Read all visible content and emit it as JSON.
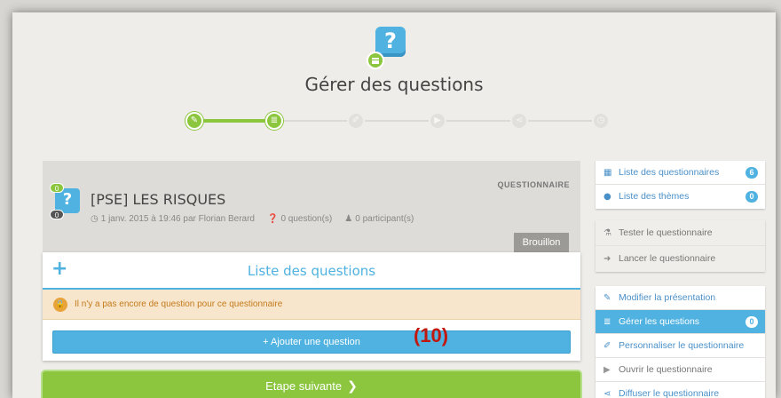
{
  "header": {
    "title": "Gérer des questions",
    "logo_icon": "question-mark-icon"
  },
  "stepper": {
    "steps": [
      {
        "icon": "pencil-icon",
        "glyph": "✎",
        "state": "done"
      },
      {
        "icon": "list-icon",
        "glyph": "≣",
        "state": "current"
      },
      {
        "icon": "brush-icon",
        "glyph": "✐",
        "state": "todo"
      },
      {
        "icon": "play-icon",
        "glyph": "▶",
        "state": "todo"
      },
      {
        "icon": "share-icon",
        "glyph": "⋖",
        "state": "todo"
      },
      {
        "icon": "clock-icon",
        "glyph": "◷",
        "state": "todo"
      }
    ]
  },
  "questionnaire": {
    "title": "[PSE] LES RISQUES",
    "type_label": "QUESTIONNAIRE",
    "badge_top": "0",
    "badge_bottom": "0",
    "date": "1 janv. 2015 à 19:46 par Florian Berard",
    "questions_count": "0 question(s)",
    "participants_count": "0 participant(s)",
    "status": "Brouillon"
  },
  "questions_panel": {
    "title": "Liste des questions",
    "add_glyph": "+",
    "alert_text": "Il n'y a pas encore de question pour ce questionnaire",
    "add_button": "+ Ajouter une question"
  },
  "annotation": "(10)",
  "next_button": {
    "label": "Etape suivante",
    "chevron": "❯"
  },
  "sidebar": {
    "group1": [
      {
        "label": "Liste des questionnaires",
        "icon": "grid-icon",
        "glyph": "▦",
        "count": "6"
      },
      {
        "label": "Liste des thèmes",
        "icon": "drop-icon",
        "glyph": "●",
        "count": "0"
      }
    ],
    "group2": [
      {
        "label": "Tester le questionnaire",
        "icon": "flask-icon",
        "glyph": "⚗"
      },
      {
        "label": "Lancer le questionnaire",
        "icon": "sign-in-icon",
        "glyph": "➜"
      }
    ],
    "group3": [
      {
        "label": "Modifier la présentation",
        "icon": "pencil-icon",
        "glyph": "✎"
      },
      {
        "label": "Gérer les questions",
        "icon": "list-icon",
        "glyph": "≣",
        "count": "0",
        "active": true
      },
      {
        "label": "Personnaliser le questionnaire",
        "icon": "brush-icon",
        "glyph": "✐"
      },
      {
        "label": "Ouvrir le questionnaire",
        "icon": "play-icon",
        "glyph": "▶"
      },
      {
        "label": "Diffuser le questionnaire",
        "icon": "share-icon",
        "glyph": "⋖"
      }
    ]
  },
  "colors": {
    "accent_blue": "#4fb2e0",
    "accent_green": "#8cc63f",
    "alert_bg": "#f7e6cc",
    "annotation_red": "#c0180f"
  }
}
